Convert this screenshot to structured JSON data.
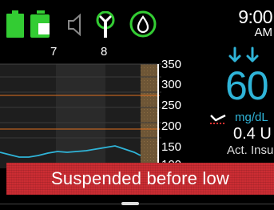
{
  "status_bar": {
    "icons": [
      "battery-icon",
      "reservoir-icon",
      "speaker-muted-icon",
      "antenna-icon",
      "sensor-icon"
    ],
    "time": "9:00",
    "ampm": "AM",
    "accent_green": "#33cc33"
  },
  "graph": {
    "x_labels": [
      "7",
      "8"
    ],
    "y_labels": [
      "350",
      "300",
      "250",
      "200",
      "150",
      "100"
    ],
    "line_color": "#2fb4d8",
    "limit_color": "#e07020"
  },
  "reading": {
    "trend": "down-down-arrows-icon",
    "value": "60",
    "units": "mg/dL",
    "color": "#2fb4d8"
  },
  "insulin": {
    "value": "0.4 U",
    "label": "Act. Insulin"
  },
  "banner": {
    "text": "Suspended before low",
    "color": "#cc2d33"
  }
}
